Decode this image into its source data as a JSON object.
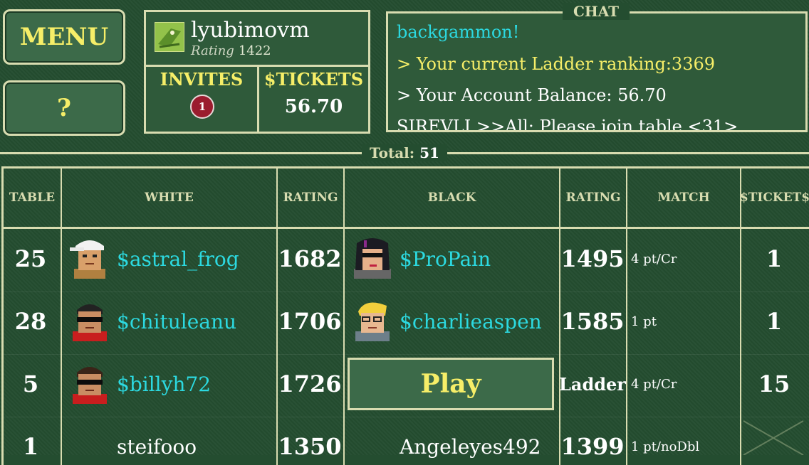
{
  "menu": {
    "label": "MENU"
  },
  "help": {
    "label": "?"
  },
  "user": {
    "name": "lyubimovm",
    "rating_label": "Rating",
    "rating": "1422",
    "invites_label": "INVITES",
    "invites_count": "1",
    "tickets_label": "$TICKETS",
    "tickets_value": "56.70"
  },
  "chat": {
    "title": "CHAT",
    "lines": [
      "backgammon!",
      "> Your current Ladder ranking:3369",
      "> Your Account Balance: 56.70",
      "SIREVLI >>All: Please join table <31>"
    ]
  },
  "total": {
    "label": "Total:",
    "value": "51"
  },
  "columns": [
    "TABLE",
    "WHITE",
    "RATING",
    "BLACK",
    "RATING",
    "MATCH",
    "$TICKET$"
  ],
  "rows": [
    {
      "table": "25",
      "white": "$astral_frog",
      "white_rating": "1682",
      "black": "$ProPain",
      "black_rating": "1495",
      "match": "4 pt/Cr",
      "tickets": "1"
    },
    {
      "table": "28",
      "white": "$chituleanu",
      "white_rating": "1706",
      "black": "$charlieaspen",
      "black_rating": "1585",
      "match": "1 pt",
      "tickets": "1"
    },
    {
      "table": "5",
      "white": "$billyh72",
      "white_rating": "1726",
      "black_action": "Play",
      "black_rating": "Ladder",
      "match": "4 pt/Cr",
      "tickets": "15"
    },
    {
      "table": "1",
      "white": "steifooo",
      "white_rating": "1350",
      "black": "Angeleyes492",
      "black_rating": "1399",
      "match": "1 pt/noDbl",
      "tickets": ""
    }
  ],
  "colors": {
    "felt": "#244d30",
    "accent_yellow": "#f6ee68",
    "name_cyan": "#2cd9e0",
    "border": "#d8dcb0"
  },
  "icons": [
    "user-avatar-icon",
    "notification-badge",
    "player-avatar-icon",
    "close-x-icon"
  ]
}
